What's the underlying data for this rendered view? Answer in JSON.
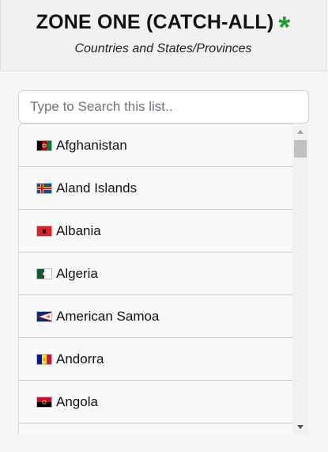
{
  "header": {
    "title": "ZONE ONE (CATCH-ALL)",
    "asterisk": "*",
    "subtitle": "Countries and States/Provinces",
    "accent_color": "#1f9d2a"
  },
  "search": {
    "placeholder": "Type to Search this list.."
  },
  "list": {
    "items": [
      {
        "label": "Afghanistan",
        "icon": "flag-afghanistan-icon"
      },
      {
        "label": "Aland Islands",
        "icon": "flag-aland-islands-icon"
      },
      {
        "label": "Albania",
        "icon": "flag-albania-icon"
      },
      {
        "label": "Algeria",
        "icon": "flag-algeria-icon"
      },
      {
        "label": "American Samoa",
        "icon": "flag-american-samoa-icon"
      },
      {
        "label": "Andorra",
        "icon": "flag-andorra-icon"
      },
      {
        "label": "Angola",
        "icon": "flag-angola-icon"
      }
    ]
  }
}
